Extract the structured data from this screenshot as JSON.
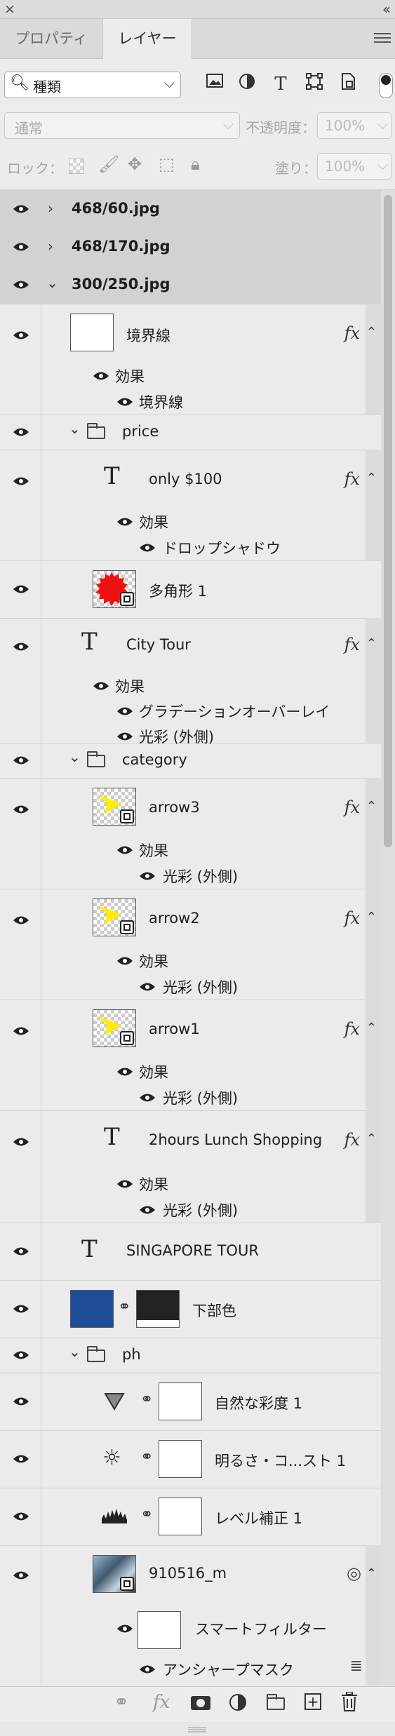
{
  "window": {
    "close_glyph": "×",
    "collapse_glyph": "‹‹"
  },
  "tabs": [
    {
      "label": "プロパティ"
    },
    {
      "label": "レイヤー"
    }
  ],
  "filter": {
    "kind_label": "種類",
    "icons": [
      "image-filter-icon",
      "adjustment-filter-icon",
      "type-filter-icon",
      "shape-filter-icon",
      "smartobject-filter-icon",
      "filter-toggle-icon"
    ]
  },
  "blend": {
    "mode": "通常",
    "opacity_label": "不透明度：",
    "opacity_value": "100%",
    "fill_label": "塗り：",
    "fill_value": "100%"
  },
  "lock": {
    "label": "ロック："
  },
  "layers": {
    "g1": "468/60.jpg",
    "g2": "468/170.jpg",
    "g3": "300/250.jpg",
    "border_layer": "境界線",
    "effects": "効果",
    "stroke_effect": "境界線",
    "price_group": "price",
    "only100": "only $100",
    "drop_shadow": "ドロップシャドウ",
    "polygon": "多角形 1",
    "city_tour": "City Tour",
    "gradient_overlay": "グラデーションオーバーレイ",
    "outer_glow": "光彩 (外側)",
    "category_group": "category",
    "arrow3": "arrow3",
    "arrow2": "arrow2",
    "arrow1": "arrow1",
    "lunch": "2hours Lunch Shopping",
    "singapore": "SINGAPORE TOUR",
    "bottom_color": "下部色",
    "ph_group": "ph",
    "vibrance": "自然な彩度 1",
    "brightness": "明るさ・コ...スト 1",
    "levels": "レベル補正 1",
    "photo": "910516_m",
    "smart_filter": "スマートフィルター",
    "unsharp": "アンシャープマスク"
  },
  "fx_label": "fx",
  "colors": {
    "accent_blue": "#1f4d99",
    "dark_fill": "#222222",
    "red": "#ee1111",
    "yellow": "#ffee00"
  }
}
